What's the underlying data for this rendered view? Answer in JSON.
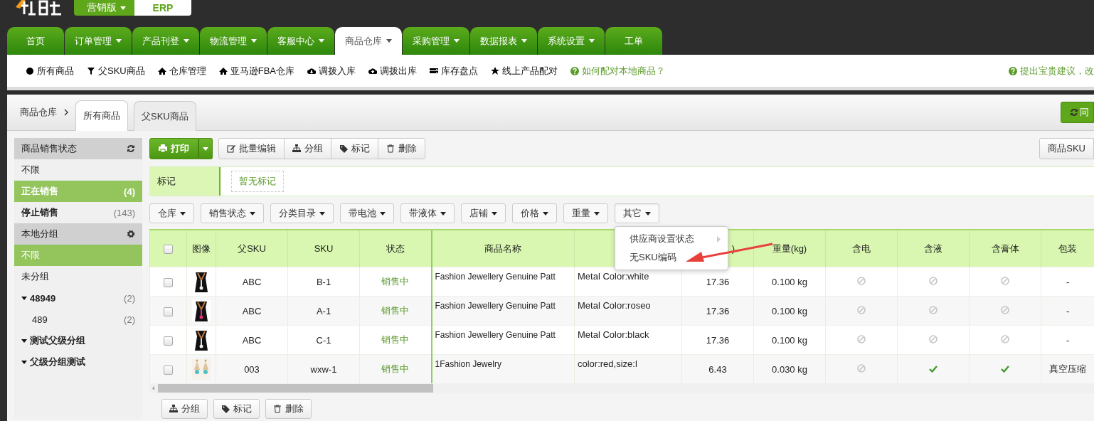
{
  "header": {
    "edition": {
      "label": "营销版",
      "has_menu": true
    },
    "product_tab": "ERP"
  },
  "nav": [
    {
      "label": "首页",
      "has_menu": false,
      "selected": false
    },
    {
      "label": "订单管理",
      "has_menu": true,
      "selected": false
    },
    {
      "label": "产品刊登",
      "has_menu": true,
      "selected": false
    },
    {
      "label": "物流管理",
      "has_menu": true,
      "selected": false
    },
    {
      "label": "客服中心",
      "has_menu": true,
      "selected": false
    },
    {
      "label": "商品仓库",
      "has_menu": true,
      "selected": true
    },
    {
      "label": "采购管理",
      "has_menu": true,
      "selected": false
    },
    {
      "label": "数据报表",
      "has_menu": true,
      "selected": false
    },
    {
      "label": "系统设置",
      "has_menu": true,
      "selected": false
    },
    {
      "label": "工单",
      "has_menu": false,
      "selected": false
    }
  ],
  "subnav": {
    "items": [
      {
        "kind": "dot",
        "label": "所有商品"
      },
      {
        "kind": "filter",
        "label": "父SKU商品"
      },
      {
        "kind": "home",
        "label": "仓库管理"
      },
      {
        "kind": "home",
        "label": "亚马逊FBA仓库"
      },
      {
        "kind": "cloud-down",
        "label": "调拨入库"
      },
      {
        "kind": "cloud-up",
        "label": "调拨出库"
      },
      {
        "kind": "server",
        "label": "库存盘点"
      },
      {
        "kind": "star",
        "label": "线上产品配对"
      }
    ],
    "help_link": "如何配对本地商品？",
    "feedback_link": "提出宝贵建议，改"
  },
  "breadcrumb": "商品仓库",
  "tabs": [
    {
      "label": "所有商品",
      "selected": true
    },
    {
      "label": "父SKU商品",
      "selected": false
    }
  ],
  "sync_button": "同",
  "sidebar": [
    {
      "title": "商品销售状态",
      "kind": "refresh",
      "items": [
        {
          "label": "不限",
          "kind": "plain",
          "selected": false
        },
        {
          "label": "正在销售",
          "count": "(4)",
          "kind": "strong",
          "selected": true
        },
        {
          "label": "停止销售",
          "count": "(143)",
          "kind": "strong",
          "selected": false
        }
      ]
    },
    {
      "title": "本地分组",
      "kind": "gear",
      "items": [
        {
          "label": "不限",
          "kind": "plain",
          "selected": true
        },
        {
          "label": "未分组",
          "kind": "plain",
          "selected": false
        },
        {
          "label": "48949",
          "count": "(2)",
          "kind": "group",
          "selected": false,
          "children": [
            {
              "label": "489",
              "count": "(2)",
              "kind": "plain",
              "selected": false
            }
          ]
        },
        {
          "label": "测试父级分组",
          "kind": "group",
          "selected": false
        },
        {
          "label": "父级分组测试",
          "kind": "group",
          "selected": false
        }
      ]
    }
  ],
  "toolbar": {
    "print": "打印",
    "actions": [
      {
        "kind": "edit",
        "label": "批量编辑"
      },
      {
        "kind": "sitemap",
        "label": "分组"
      },
      {
        "kind": "tag",
        "label": "标记"
      },
      {
        "kind": "trash",
        "label": "删除"
      }
    ],
    "sku_button": "商品SKU"
  },
  "marks": {
    "label": "标记",
    "empty_text": "暂无标记"
  },
  "filters": [
    {
      "label": "仓库"
    },
    {
      "label": "销售状态"
    },
    {
      "label": "分类目录"
    },
    {
      "label": "带电池"
    },
    {
      "label": "带液体"
    },
    {
      "label": "店铺"
    },
    {
      "label": "价格"
    },
    {
      "label": "重量"
    },
    {
      "label": "其它",
      "expanded": true
    }
  ],
  "dropdown": [
    {
      "label": "供应商设置状态",
      "has_submenu": true
    },
    {
      "label": "无SKU编码",
      "has_submenu": false
    }
  ],
  "table": {
    "header_checked": false,
    "columns": [
      {
        "label": "图像"
      },
      {
        "label": "父SKU"
      },
      {
        "label": "SKU"
      },
      {
        "label": "状态"
      },
      {
        "label": "商品名称"
      },
      {},
      {
        "label": ")"
      },
      {
        "label": "重量(kg)"
      },
      {
        "label": "含电"
      },
      {
        "label": "含液"
      },
      {
        "label": "含膏体"
      },
      {
        "label": "包装"
      }
    ],
    "rows": [
      {
        "checked": false,
        "parent_sku": "ABC",
        "sku": "B-1",
        "status": "销售中",
        "name": "Fashion Jewellery Genuine Patt",
        "column_7": "Metal Color:white",
        "column_8": "17.36",
        "weight": "0.100 kg",
        "has_battery": false,
        "has_liquid": false,
        "has_paste": false,
        "packaging": "-"
      },
      {
        "checked": false,
        "parent_sku": "ABC",
        "sku": "A-1",
        "status": "销售中",
        "name": "Fashion Jewellery Genuine Patt",
        "column_7": "Metal Color:roseo",
        "column_8": "17.36",
        "weight": "0.100 kg",
        "has_battery": false,
        "has_liquid": false,
        "has_paste": false,
        "packaging": "-"
      },
      {
        "checked": false,
        "parent_sku": "ABC",
        "sku": "C-1",
        "status": "销售中",
        "name": "Fashion Jewellery Genuine Patt",
        "column_7": "Metal Color:black",
        "column_8": "17.36",
        "weight": "0.100 kg",
        "has_battery": false,
        "has_liquid": false,
        "has_paste": false,
        "packaging": "-"
      },
      {
        "checked": false,
        "parent_sku": "003",
        "sku": "wxw-1",
        "status": "销售中",
        "name": "1Fashion Jewelry",
        "column_7": "color:red,size:l",
        "column_8": "6.43",
        "weight": "0.030 kg",
        "has_battery": false,
        "has_liquid": true,
        "has_paste": true,
        "packaging": "真空压缩"
      }
    ]
  },
  "footer_actions": [
    {
      "kind": "sitemap",
      "label": "分组"
    },
    {
      "kind": "tag",
      "label": "标记"
    },
    {
      "kind": "trash",
      "label": "删除"
    }
  ]
}
